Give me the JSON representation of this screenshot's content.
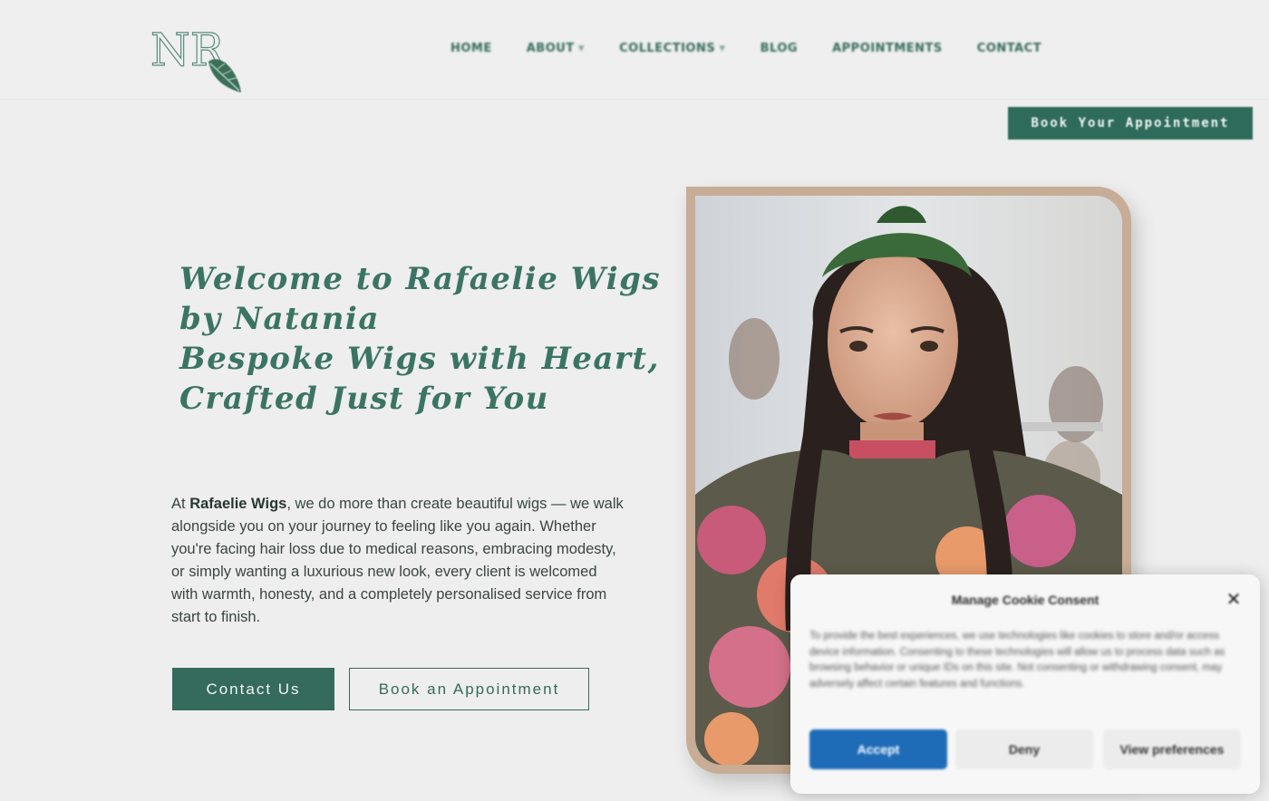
{
  "header": {
    "logo_text": "NR",
    "nav": [
      {
        "label": "HOME",
        "has_dropdown": false
      },
      {
        "label": "ABOUT",
        "has_dropdown": true
      },
      {
        "label": "COLLECTIONS",
        "has_dropdown": true
      },
      {
        "label": "BLOG",
        "has_dropdown": false
      },
      {
        "label": "APPOINTMENTS",
        "has_dropdown": false
      },
      {
        "label": "CONTACT",
        "has_dropdown": false
      }
    ],
    "cta_label": "Book Your Appointment"
  },
  "hero": {
    "title_lines": [
      "Welcome to Rafaelie Wigs",
      "by Natania",
      "Bespoke Wigs with Heart,",
      "Crafted Just for You"
    ],
    "intro_prefix": "At ",
    "intro_brand": "Rafaelie Wigs",
    "intro_rest": ", we do more than create beautiful wigs — we walk alongside you on your journey to feeling like you again. Whether you're facing hair loss due to medical reasons, embracing modesty, or simply wanting a luxurious new look, every client is welcomed with warmth, honesty, and a completely personalised service from start to finish.",
    "contact_label": "Contact Us",
    "book_label": "Book an Appointment"
  },
  "cookie": {
    "title": "Manage Cookie Consent",
    "body": "To provide the best experiences, we use technologies like cookies to store and/or access device information. Consenting to these technologies will allow us to process data such as browsing behavior or unique IDs on this site. Not consenting or withdrawing consent, may adversely affect certain features and functions.",
    "accept_label": "Accept",
    "deny_label": "Deny",
    "preferences_label": "View preferences"
  },
  "colors": {
    "brand_green": "#356b5c",
    "frame_tan": "#c7ad95",
    "accept_blue": "#1e6bb8",
    "background": "#eeeeee"
  },
  "icons": {
    "close": "close-icon",
    "dropdown": "chevron-down-icon",
    "logo_leaf": "leaf-icon"
  }
}
